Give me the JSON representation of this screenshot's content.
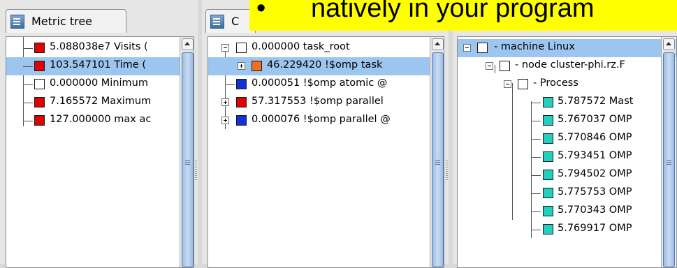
{
  "metric_tab": {
    "title": "Metric tree"
  },
  "call_tab": {
    "title": "C"
  },
  "banner": {
    "bullet": "•",
    "text": "natively in your program"
  },
  "metric_rows": [
    {
      "text": "5.088038e7 Visits (",
      "color": "#e00000",
      "selected": false
    },
    {
      "text": "103.547101 Time (",
      "color": "#e00000",
      "selected": true
    },
    {
      "text": "0.000000 Minimum",
      "color": "#ffffff",
      "selected": false
    },
    {
      "text": "7.165572 Maximum",
      "color": "#e00000",
      "selected": false
    },
    {
      "text": "127.000000 max ac",
      "color": "#e00000",
      "selected": false
    }
  ],
  "call_rows": [
    {
      "text": "0.000000 task_root",
      "color": "#ffffff",
      "expander": "minus"
    },
    {
      "text": "46.229420 !$omp task",
      "color": "#f07020",
      "expander": "plus",
      "selected": true
    },
    {
      "text": "0.000051 !$omp atomic @",
      "color": "#1030d8",
      "expander": "none"
    },
    {
      "text": "57.317553 !$omp parallel",
      "color": "#e00000",
      "expander": "plus"
    },
    {
      "text": "0.000076 !$omp parallel @",
      "color": "#1030d8",
      "expander": "plus"
    }
  ],
  "system_rows": [
    {
      "text": "- machine Linux",
      "color": "#ffffff",
      "expander": "minus",
      "selected": true
    },
    {
      "text": "- node cluster-phi.rz.F",
      "color": "#ffffff",
      "expander": "minus"
    },
    {
      "text": "- Process",
      "color": "#ffffff",
      "expander": "minus"
    },
    {
      "text": "5.787572 Mast",
      "color": "#20d0c0"
    },
    {
      "text": "5.767037 OMP",
      "color": "#20d0c0"
    },
    {
      "text": "5.770846 OMP",
      "color": "#20d0c0"
    },
    {
      "text": "5.793451 OMP",
      "color": "#20d0c0"
    },
    {
      "text": "5.794502 OMP",
      "color": "#20d0c0"
    },
    {
      "text": "5.775753 OMP",
      "color": "#20d0c0"
    },
    {
      "text": "5.770343 OMP",
      "color": "#20d0c0"
    },
    {
      "text": "5.769917 OMP",
      "color": "#20d0c0"
    }
  ]
}
